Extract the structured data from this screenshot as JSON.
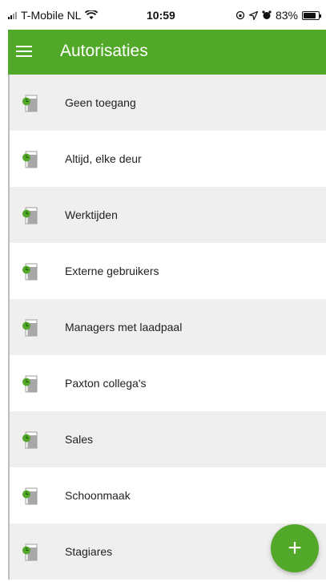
{
  "status_bar": {
    "carrier": "T-Mobile NL",
    "time": "10:59",
    "battery_percent": "83%"
  },
  "header": {
    "title": "Autorisaties",
    "menu_icon": "hamburger-menu-icon"
  },
  "list": {
    "items": [
      {
        "label": "Geen toegang"
      },
      {
        "label": "Altijd, elke deur"
      },
      {
        "label": "Werktijden"
      },
      {
        "label": "Externe gebruikers"
      },
      {
        "label": "Managers met laadpaal"
      },
      {
        "label": "Paxton collega's"
      },
      {
        "label": "Sales"
      },
      {
        "label": "Schoonmaak"
      },
      {
        "label": "Stagiares"
      }
    ]
  },
  "fab": {
    "label": "+"
  },
  "colors": {
    "accent": "#52a829",
    "row_alt": "#efefef",
    "door_icon": "#a8a8a8"
  }
}
